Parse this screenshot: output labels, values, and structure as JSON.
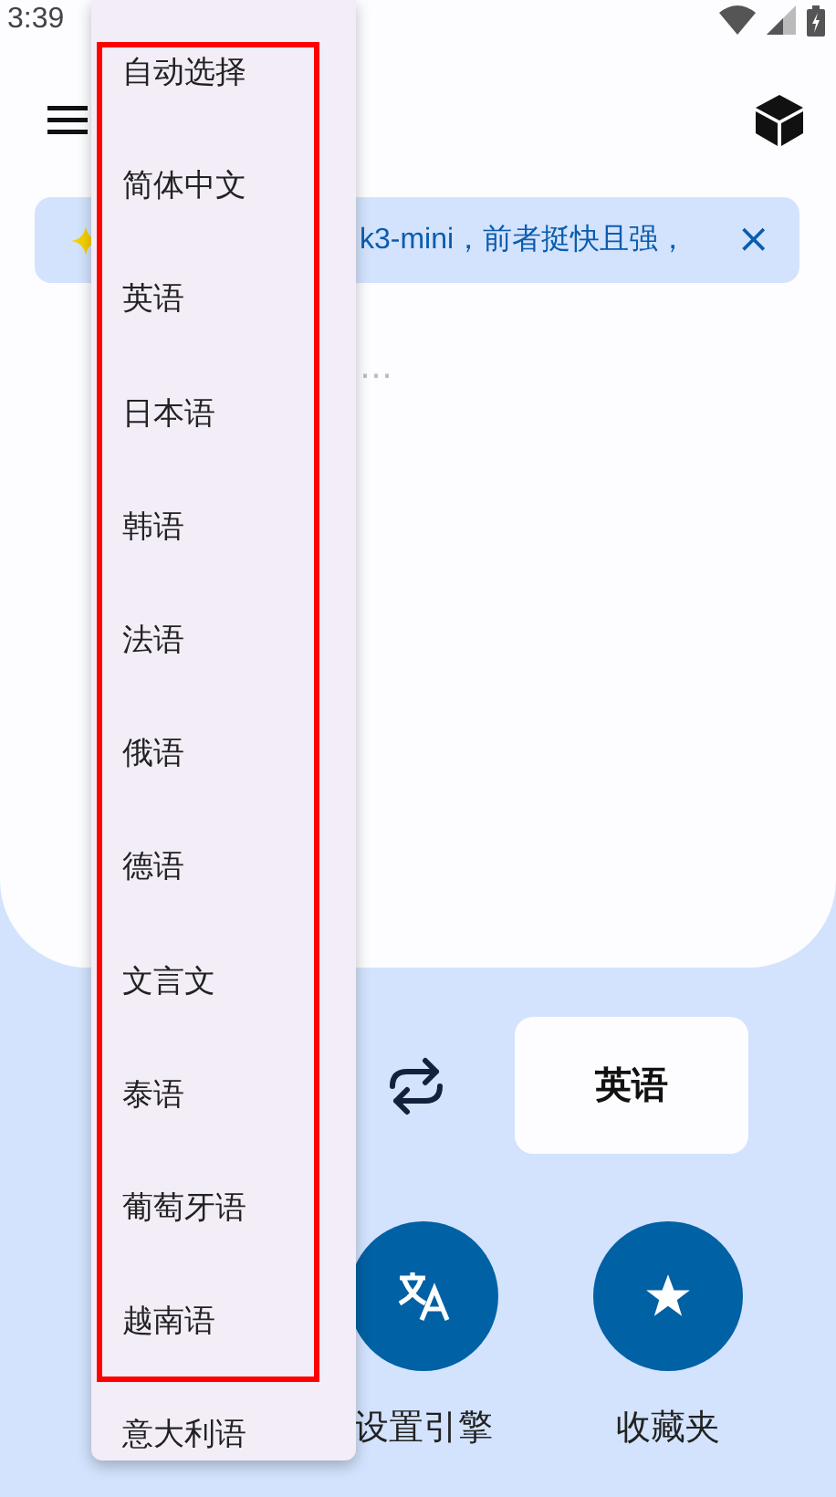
{
  "status_bar": {
    "time": "3:39"
  },
  "banner": {
    "text": "k3-mini，前者挺快且强，",
    "close": "×"
  },
  "input": {
    "placeholder": "……"
  },
  "languages": {
    "target": "英语"
  },
  "actions": [
    {
      "label": "设置引擎",
      "kind": "engine"
    },
    {
      "label": "收藏夹",
      "kind": "favorites"
    }
  ],
  "menu": {
    "items": [
      "自动选择",
      "简体中文",
      "英语",
      "日本语",
      "韩语",
      "法语",
      "俄语",
      "德语",
      "文言文",
      "泰语",
      "葡萄牙语",
      "越南语",
      "意大利语"
    ]
  }
}
